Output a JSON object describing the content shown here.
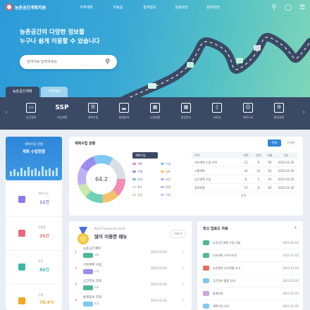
{
  "header": {
    "logo_text": "농촌공간계획지원",
    "nav": [
      "지역계획",
      "자료실",
      "통계정보",
      "알림마당",
      "참여마당"
    ],
    "icons": [
      "search-icon",
      "user-icon",
      "menu-icon"
    ]
  },
  "hero": {
    "title_line1": "농촌공간의 다양한 정보를",
    "title_line2": "누구나 쉽게 이용할 수 있습니다",
    "search_placeholder": "검색어를 입력하세요",
    "tabs": [
      "농촌공간계획",
      "기본계획"
    ]
  },
  "quick_menu": [
    {
      "icon": "monitor-icon",
      "label": "공간정보"
    },
    {
      "icon": "text-icon",
      "glyph": "SSP",
      "label": "사업계획"
    },
    {
      "icon": "document-icon",
      "label": "계획수립"
    },
    {
      "icon": "chart-icon",
      "label": "통계분석"
    },
    {
      "icon": "building-icon",
      "label": "시설현황"
    },
    {
      "icon": "calendar-icon",
      "label": "일정관리"
    },
    {
      "icon": "bag-icon",
      "label": "자료실"
    },
    {
      "icon": "people-icon",
      "label": "커뮤니티"
    },
    {
      "icon": "settings-icon",
      "label": "환경설정"
    }
  ],
  "left_panel": {
    "top_line1": "계획수립 현황",
    "top_line2": "계획 수립현황",
    "stats": [
      {
        "label": "계획수립",
        "value": "12건",
        "color": "#8f7ae6"
      },
      {
        "label": "진행중",
        "value": "35건",
        "color": "#e86a7a"
      },
      {
        "label": "완료",
        "value": "80건",
        "color": "#3bb8a8"
      },
      {
        "label": "전체",
        "value": "76.4%",
        "color": "#f5a623"
      }
    ]
  },
  "status_panel": {
    "title": "계획수립 현황",
    "seg_buttons": [
      "전체",
      "지역별"
    ],
    "donut_center": "64.2",
    "legend_header": "계획수립",
    "legend": [
      {
        "name": "계획",
        "color": "#f28db2"
      },
      {
        "name": "수립",
        "color": "#7ec8f2"
      },
      {
        "name": "진행",
        "color": "#9c8cf0"
      },
      {
        "name": "검토",
        "color": "#f5c26b"
      },
      {
        "name": "완료",
        "color": "#6fd0b6"
      },
      {
        "name": "보류",
        "color": "#bdb0f5"
      },
      {
        "name": "취소",
        "color": "#d9dde4"
      },
      {
        "name": "변경",
        "color": "#a9c4f5"
      },
      {
        "name": "승인",
        "color": "#c8e8ad"
      },
      {
        "name": "기타",
        "color": "#e6b8f0"
      }
    ],
    "table": {
      "headers": [
        "지역",
        "계획",
        "완료",
        "비율",
        "일자"
      ],
      "rows": [
        [
          "기본계획 수립 지역",
          "12",
          "8",
          "66",
          "2023.01.02"
        ],
        [
          "시행계획",
          "34",
          "21",
          "62",
          "2023.01.02"
        ],
        [
          "공간계획 수립",
          "8",
          "5",
          "63",
          "2023.01.02"
        ],
        [
          "협약체결",
          "15",
          "9",
          "60",
          "2023.01.02"
        ]
      ],
      "total": "합계"
    }
  },
  "favorites": {
    "subtitle": "Most Frequently Used",
    "title": "많이 이용한 메뉴",
    "more": "더보기",
    "rows": [
      {
        "rank": "1",
        "name": "농촌공간계획",
        "tag": "계획",
        "date": "2023.01.02"
      },
      {
        "rank": "2",
        "name": "기본계획 수립",
        "tag": "수립",
        "date": "2023.01.02"
      },
      {
        "rank": "3",
        "name": "공간정보 조회",
        "tag": "조회",
        "date": "2023.01.02"
      },
      {
        "rank": "4",
        "name": "통계정보 조회",
        "tag": "통계",
        "date": "2023.01.02"
      }
    ]
  },
  "recent": {
    "title": "최신 업로드 자료",
    "more": "+",
    "rows": [
      {
        "name": "농촌공간계획 수립 지침",
        "date": "2023.01.02",
        "color": "#4db892"
      },
      {
        "name": "기본계획 가이드라인",
        "date": "2023.01.02",
        "color": "#4db892"
      },
      {
        "name": "농촌협약 추진현황 보고",
        "date": "2023.01.02",
        "color": "#e86a5a"
      },
      {
        "name": "공간정보 활용 안내",
        "date": "2023.01.02",
        "color": "#7ec8f2"
      },
      {
        "name": "통계자료",
        "date": "2023.01.02",
        "color": "#c9a8e8"
      },
      {
        "name": "지역개발 사례집",
        "date": "2023.01.02",
        "color": "#4db892"
      },
      {
        "name": "계획수립 서식",
        "date": "2023.01.02",
        "color": "#7ec8f2"
      }
    ]
  }
}
